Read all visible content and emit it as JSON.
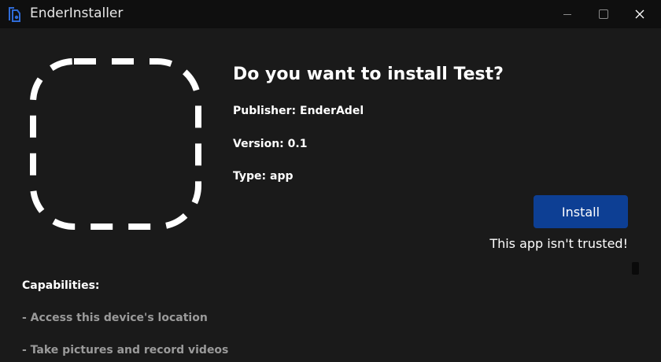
{
  "window": {
    "title": "EnderInstaller",
    "controls": {
      "minimize_icon": "minimize-icon",
      "maximize_icon": "maximize-icon",
      "close_icon": "close-icon"
    }
  },
  "app_icon": "placeholder-app-icon",
  "prompt": {
    "heading": "Do you want to install Test?",
    "publisher": "Publisher: EnderAdel",
    "version": "Version: 0.1",
    "type": "Type: app"
  },
  "actions": {
    "install_label": "Install",
    "trust_warning": "This app isn't trusted!"
  },
  "capabilities": {
    "heading": "Capabilities:",
    "items": [
      "- Access this device's location",
      "- Take pictures and record videos"
    ]
  },
  "colors": {
    "background": "#1a1a1a",
    "titlebar": "#0f0f0f",
    "accent": "#0d3f94",
    "muted_text": "#9a9a9a"
  }
}
